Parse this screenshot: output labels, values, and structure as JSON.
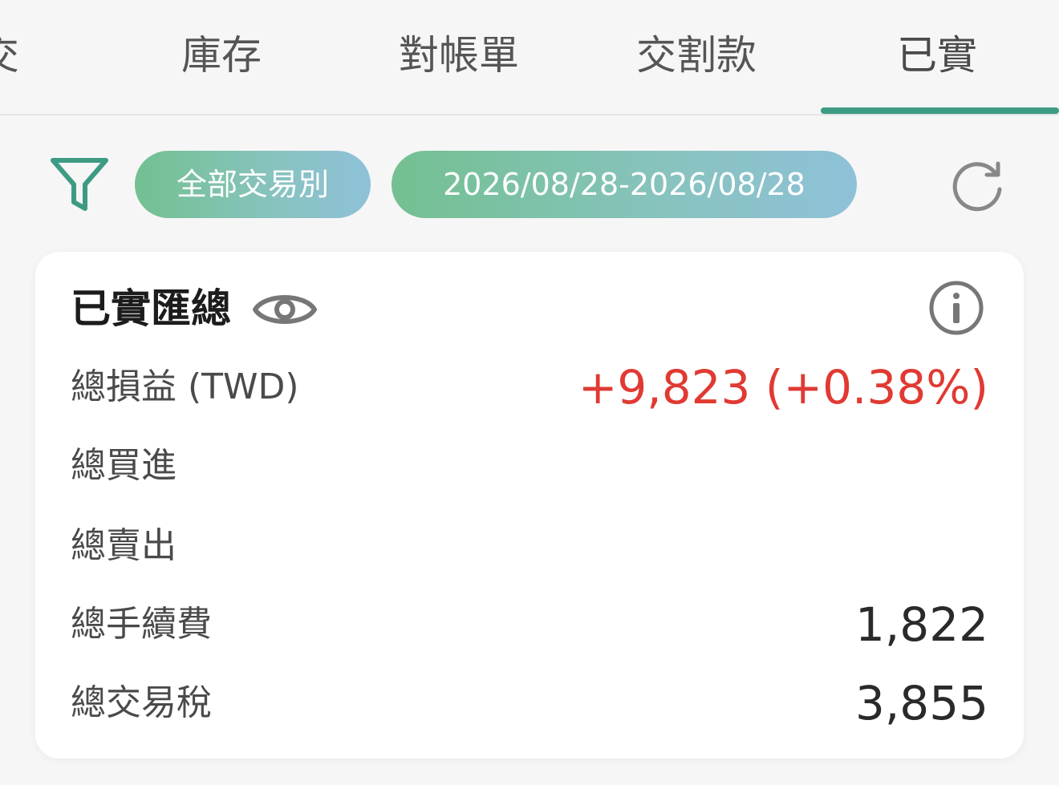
{
  "tabs": [
    {
      "label": "交"
    },
    {
      "label": "庫存"
    },
    {
      "label": "對帳單"
    },
    {
      "label": "交割款"
    },
    {
      "label": "已實"
    }
  ],
  "active_tab_index": 4,
  "filters": {
    "type_chip": "全部交易別",
    "date_chip": "2026/08/28-2026/08/28"
  },
  "summary": {
    "title": "已實匯總",
    "rows": [
      {
        "label": "總損益 (TWD)",
        "value": "+9,823 (+0.38%)"
      },
      {
        "label": "總買進",
        "value": ""
      },
      {
        "label": "總賣出",
        "value": ""
      },
      {
        "label": "總手續費",
        "value": "1,822"
      },
      {
        "label": "總交易稅",
        "value": "3,855"
      }
    ]
  },
  "colors": {
    "accent": "#3d9b84",
    "profit": "#e03a33",
    "chip_gradient_start": "#73c091",
    "chip_gradient_end": "#8ec1d8"
  },
  "icons": {
    "filter": "filter-icon",
    "refresh": "refresh-icon",
    "visibility": "eye-icon",
    "info": "info-icon"
  }
}
